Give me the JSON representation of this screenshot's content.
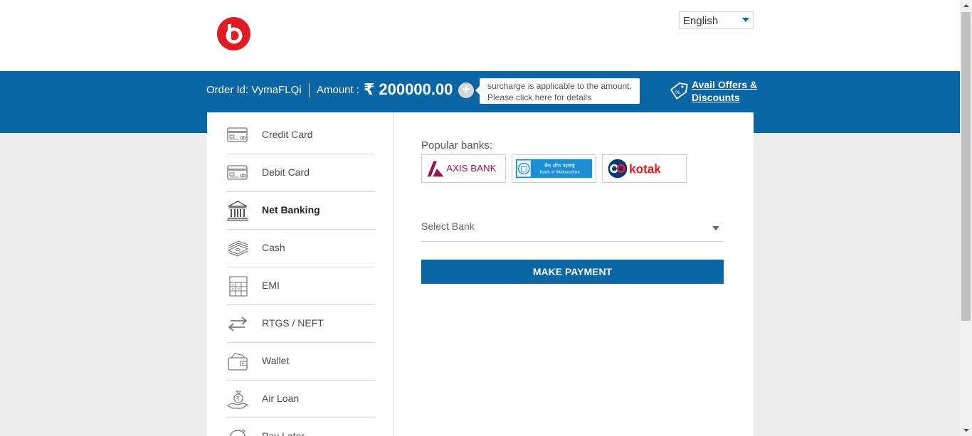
{
  "header": {
    "language": "English"
  },
  "order_bar": {
    "order_id": "Order Id: VymaFLQi",
    "amount_label": "Amount :",
    "amount_value": "₹ 200000.00",
    "plus": "+",
    "surcharge_line1": "surcharge is applicable to the amount.",
    "surcharge_line2": "Please click here for details",
    "offers_line1": "Avail Offers &",
    "offers_line2": "Discounts"
  },
  "menu": {
    "items": [
      {
        "label": "Credit Card",
        "icon": "credit-card-icon"
      },
      {
        "label": "Debit Card",
        "icon": "debit-card-icon"
      },
      {
        "label": "Net Banking",
        "icon": "bank-icon",
        "active": true
      },
      {
        "label": "Cash",
        "icon": "cash-icon"
      },
      {
        "label": "EMI",
        "icon": "calculator-icon"
      },
      {
        "label": "RTGS / NEFT",
        "icon": "transfer-icon"
      },
      {
        "label": "Wallet",
        "icon": "wallet-icon"
      },
      {
        "label": "Air Loan",
        "icon": "loan-icon"
      },
      {
        "label": "Pay Later",
        "icon": "pay-later-icon"
      }
    ]
  },
  "netbanking": {
    "popular_label": "Popular banks:",
    "banks": [
      {
        "name": "AXIS BANK"
      },
      {
        "name": "Bank of Maharashtra",
        "script": "बैंक ऑफ महाराष्ट्र"
      },
      {
        "name": "kotak"
      }
    ],
    "select_placeholder": "Select Bank",
    "pay_button": "MAKE PAYMENT"
  },
  "colors": {
    "brand_blue": "#0866a5",
    "logo_red": "#e01b24",
    "axis_maroon": "#97144d",
    "bom_blue": "#1b8fd1",
    "kotak_red": "#ed1c24",
    "kotak_navy": "#003874"
  }
}
